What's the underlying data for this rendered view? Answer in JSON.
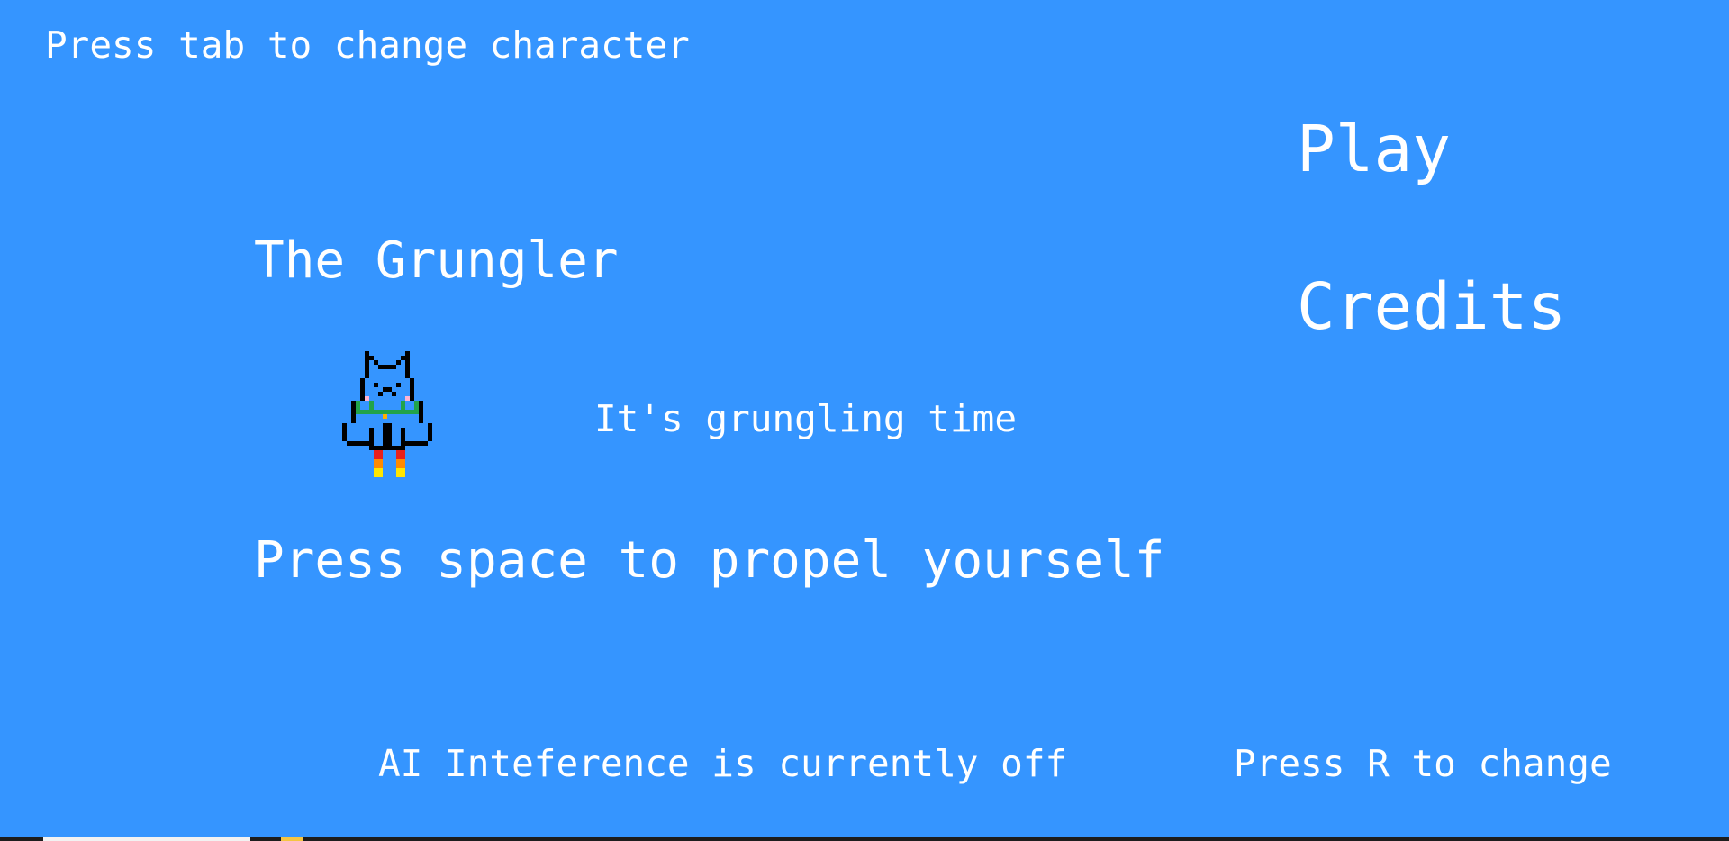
{
  "hints": {
    "change_character": "Press tab to change character",
    "propel": "Press space to propel yourself",
    "ai_status": "AI Inteference is currently off",
    "ai_toggle": "Press R to change"
  },
  "character": {
    "name": "The Grungler",
    "tagline": "It's grungling time",
    "sprite_icon": "pixel-cat-jetpack-icon"
  },
  "menu": {
    "play": "Play",
    "credits": "Credits"
  },
  "colors": {
    "background": "#3595FF",
    "text": "#FFFFFF",
    "collar": "#22A34A",
    "blush": "#FFB3D1",
    "flame_top": "#E8201A",
    "flame_mid": "#FF8A00",
    "flame_bottom": "#FFE600"
  }
}
